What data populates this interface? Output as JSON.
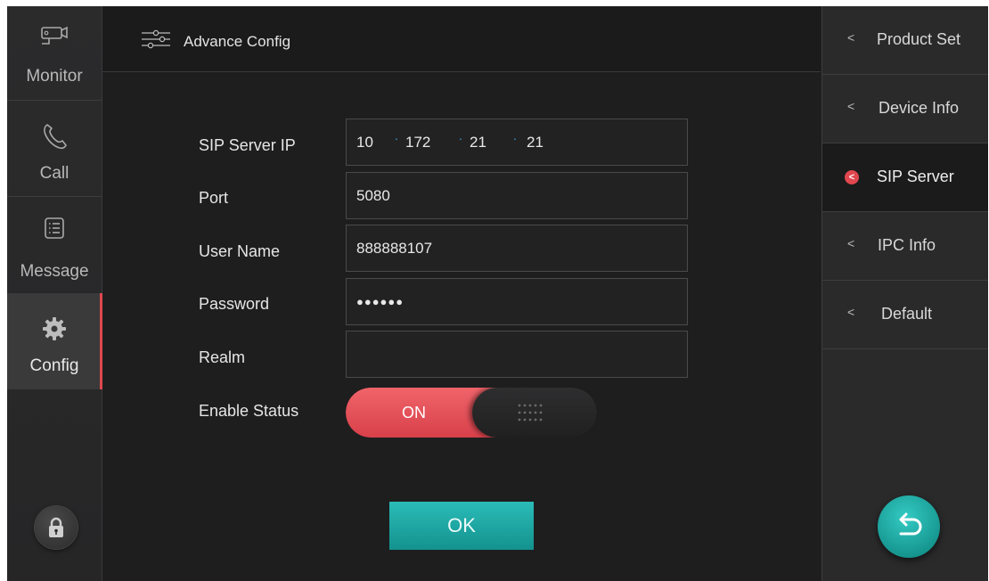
{
  "nav": {
    "monitor": "Monitor",
    "call": "Call",
    "message": "Message",
    "config": "Config"
  },
  "header": {
    "title": "Advance Config"
  },
  "form": {
    "sip_label": "SIP Server IP",
    "ip": [
      "10",
      "172",
      "21",
      "21"
    ],
    "port_label": "Port",
    "port": "5080",
    "user_label": "User Name",
    "user": "888888107",
    "password_label": "Password",
    "password": "●●●●●●",
    "realm_label": "Realm",
    "realm": "",
    "enable_label": "Enable Status",
    "enable_value": "ON"
  },
  "ok_label": "OK",
  "right": {
    "items": [
      "Product Set",
      "Device Info",
      "SIP Server",
      "IPC Info",
      "Default"
    ],
    "selected": "SIP Server"
  },
  "colors": {
    "accent_red": "#e0474e",
    "accent_teal": "#1aa9a4",
    "ip_dot": "#3aa0d8"
  }
}
